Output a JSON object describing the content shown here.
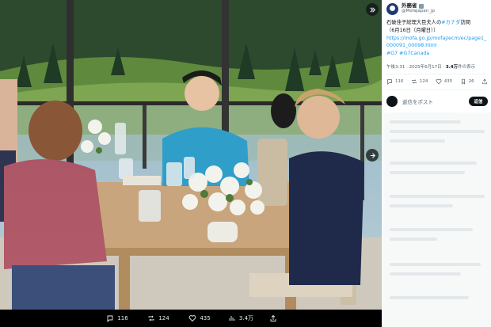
{
  "post": {
    "author_name": "外務省",
    "author_handle": "@MofaJapan_jp",
    "text_line1_prefix": "石破佳子総理大臣夫人の",
    "text_line1_hashtag": "#カナダ",
    "text_line1_suffix": "訪問",
    "text_line2": "（6月16日（月曜日））",
    "link": "https://mofa.go.jp/mofaj/ecm/ec/page1_000091_00098.html",
    "hashtags": "#G7 #G7Canada",
    "time_date": "午後3:31 · 2025年6月17日 · ",
    "views_count": "3.4万",
    "views_label": "件の表示"
  },
  "actions": {
    "replies": "116",
    "reposts": "124",
    "likes": "435",
    "bookmarks": "26"
  },
  "reply_box": {
    "placeholder": "返信をポスト",
    "button_label": "返信"
  },
  "media_bar": {
    "replies": "116",
    "reposts": "124",
    "likes": "435",
    "views": "3.4万"
  },
  "colors": {
    "accent": "#1d9bf0",
    "text_primary": "#0f1419",
    "text_secondary": "#536471"
  }
}
